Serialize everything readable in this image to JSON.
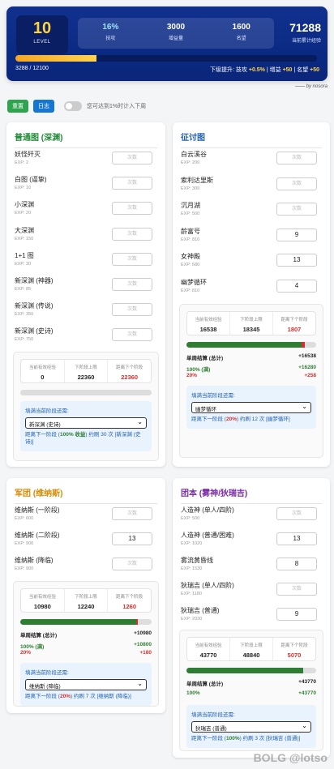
{
  "header": {
    "level": "10",
    "level_label": "LEVEL",
    "stats": [
      {
        "value": "16%",
        "label": "技攻"
      },
      {
        "value": "3000",
        "label": "增益量"
      },
      {
        "value": "1600",
        "label": "名望"
      }
    ],
    "total_value": "71288",
    "total_label": "当前累计经验",
    "progress_fraction": 0.27,
    "progress_text": "3288 / 12100",
    "boost_prefix": "下级提升: 技攻",
    "boost_a": "+0.5%",
    "boost_b_label": "| 增益",
    "boost_b": "+50",
    "boost_c_label": "| 名望",
    "boost_c": "+50",
    "author": "—— by nosora"
  },
  "toolbar": {
    "reset": "重置",
    "log": "日志",
    "toggle_label": "您可达到1%时计入下周"
  },
  "cards": {
    "normal": {
      "title": "普通图 (深渊)",
      "rows": [
        {
          "name": "妖怪歼灭",
          "exp": "EXP: 2",
          "value": "",
          "ph": "次数"
        },
        {
          "name": "白图 (逼挚)",
          "exp": "EXP: 10",
          "value": "",
          "ph": "次数"
        },
        {
          "name": "小深渊",
          "exp": "EXP: 20",
          "value": "",
          "ph": "次数"
        },
        {
          "name": "大深渊",
          "exp": "EXP: 150",
          "value": "",
          "ph": "次数"
        },
        {
          "name": "1+1 图",
          "exp": "EXP: 30",
          "value": "",
          "ph": "次数"
        },
        {
          "name": "新深渊 (神器)",
          "exp": "EXP: 85",
          "value": "",
          "ph": "次数"
        },
        {
          "name": "新深渊 (传说)",
          "exp": "EXP: 350",
          "value": "",
          "ph": "次数"
        },
        {
          "name": "新深渊 (史诗)",
          "exp": "EXP: 750",
          "value": "",
          "ph": "次数"
        }
      ],
      "sum": {
        "l1": "当前有效经验",
        "v1": "0",
        "l2": "下阶段上限",
        "v2": "22360",
        "l3": "距离下个阶段",
        "v3": "22360"
      },
      "bar_green": 0.0,
      "bar_red": 0.0,
      "select_prompt": "填满当前阶段还需:",
      "select_value": "新深渊 (史诗)",
      "tip_a": "距离下一阶段 (",
      "tip_pct": "100% 收益",
      "tip_b": ") 约刷 30 次 [新深渊 (史诗)]"
    },
    "expedition": {
      "title": "征讨图",
      "rows": [
        {
          "name": "白云溪谷",
          "exp": "EXP: 200",
          "value": "",
          "ph": "次数"
        },
        {
          "name": "索利达里斯",
          "exp": "EXP: 300",
          "value": "",
          "ph": "次数"
        },
        {
          "name": "沉月湖",
          "exp": "EXP: 500",
          "value": "",
          "ph": "次数"
        },
        {
          "name": "龄富号",
          "exp": "EXP: 810",
          "value": "9",
          "ph": ""
        },
        {
          "name": "女神殿",
          "exp": "EXP: 680",
          "value": "13",
          "ph": ""
        },
        {
          "name": "幽梦循环",
          "exp": "EXP: 810",
          "value": "4",
          "ph": ""
        }
      ],
      "sum": {
        "l1": "当前有效经验",
        "v1": "16538",
        "l2": "下阶段上限",
        "v2": "18345",
        "l3": "距离下个阶段",
        "v3": "1807"
      },
      "bar_green": 0.89,
      "bar_red": 0.02,
      "total_label": "单周结算 (总计)",
      "total_value": "+16538",
      "g_label": "100% (满)",
      "g_value": "+16280",
      "r_label": "20%",
      "r_value": "+258",
      "select_prompt": "填满当前阶段还需:",
      "select_value": "幽梦循环",
      "tip_a": "距离下一阶段 (",
      "tip_pct": "20%",
      "tip_b": ") 约刷 12 次 [幽梦循环]"
    },
    "legion": {
      "title": "军团 (维纳斯)",
      "rows": [
        {
          "name": "维纳斯 (一阶段)",
          "exp": "EXP: 600",
          "value": "",
          "ph": "次数"
        },
        {
          "name": "维纳斯 (二阶段)",
          "exp": "EXP: 900",
          "value": "13",
          "ph": ""
        },
        {
          "name": "维纳斯 (降临)",
          "exp": "EXP: 900",
          "value": "",
          "ph": "次数"
        }
      ],
      "sum": {
        "l1": "当前有效经验",
        "v1": "10980",
        "l2": "下阶段上限",
        "v2": "12240",
        "l3": "距离下个阶段",
        "v3": "1260"
      },
      "bar_green": 0.88,
      "bar_red": 0.015,
      "total_label": "单周结算 (总计)",
      "total_value": "+10980",
      "g_label": "100% (满)",
      "g_value": "+10800",
      "r_label": "20%",
      "r_value": "+180",
      "select_prompt": "填满当前阶段还需:",
      "select_value": "维纳斯 (降临)",
      "tip_a": "距离下一阶段 (",
      "tip_pct": "20%",
      "tip_b": ") 约刷 7 次 [维纳斯 (降临)]"
    },
    "raid": {
      "title": "团本 (雾神/狄瑞吉)",
      "rows": [
        {
          "name": "人造神 (单人/四阶)",
          "exp": "EXP: 500",
          "value": "",
          "ph": "次数"
        },
        {
          "name": "人造神 (普通/困难)",
          "exp": "EXP: 1020",
          "value": "13",
          "ph": ""
        },
        {
          "name": "雾流黄昏线",
          "exp": "EXP: 1530",
          "value": "8",
          "ph": ""
        },
        {
          "name": "狄瑞吉 (单人/四阶)",
          "exp": "EXP: 1180",
          "value": "",
          "ph": "次数"
        },
        {
          "name": "狄瑞吉 (普通)",
          "exp": "EXP: 2030",
          "value": "9",
          "ph": ""
        }
      ],
      "sum": {
        "l1": "当前有效经验",
        "v1": "43770",
        "l2": "下阶段上限",
        "v2": "48840",
        "l3": "距离下个阶段",
        "v3": "5070"
      },
      "bar_green": 0.9,
      "bar_red": 0.0,
      "total_label": "单周结算 (总计)",
      "total_value": "+43770",
      "g_label": "100%",
      "g_value": "+43770",
      "select_prompt": "填满当前阶段还需:",
      "select_value": "狄瑞吉 (普通)",
      "tip_a": "距离下一阶段 (",
      "tip_pct": "100%",
      "tip_b": ") 约刷 3 次 [狄瑞吉 (普通)]"
    }
  },
  "watermark": "BOLG @lotso"
}
